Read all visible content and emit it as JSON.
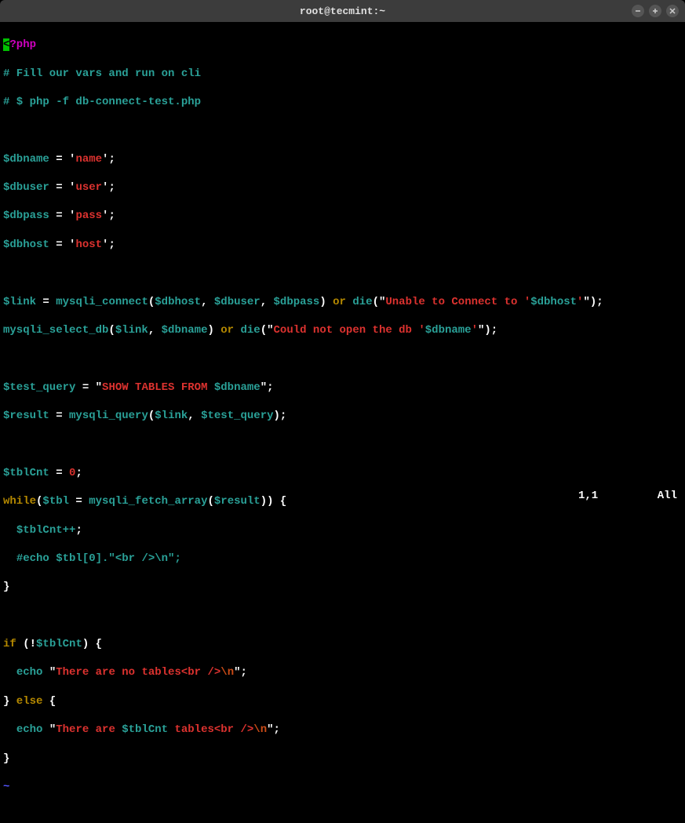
{
  "titlebar": {
    "title": "root@tecmint:~"
  },
  "code": {
    "open_tag": "<?php",
    "comment1": "# Fill our vars and run on cli",
    "comment2": "# $ php -f db-connect-test.php",
    "var_dbname": "$dbname",
    "eq": " = ",
    "q": "'",
    "val_name": "name",
    "semi": ";",
    "var_dbuser": "$dbuser",
    "val_user": "user",
    "var_dbpass": "$dbpass",
    "val_pass": "pass",
    "var_dbhost": "$dbhost",
    "val_host": "host",
    "var_link": "$link",
    "fn_connect": "mysqli_connect",
    "lp": "(",
    "rp": ")",
    "comma": ", ",
    "op_or": " or ",
    "fn_die": "die",
    "dq": "\"",
    "str_unable1": "Unable to Connect to ",
    "str_unable2": "'",
    "fn_selectdb": "mysqli_select_db",
    "str_could_not": "Could not open the db ",
    "var_test_query": "$test_query",
    "sql_show": "SHOW TABLES FROM ",
    "var_result": "$result",
    "fn_query": "mysqli_query",
    "var_tblcnt": "$tblCnt",
    "zero": "0",
    "kw_while": "while",
    "var_tbl": "$tbl",
    "fn_fetch": "mysqli_fetch_array",
    "brace_open": " {",
    "brace_close": "}",
    "indent_tblcnt": "  $tblCnt++",
    "indent_hash": "  #",
    "comment_echo": "echo $tbl[0].\"<br />\\n\";",
    "bracket_open": "[",
    "bracket_close": "]",
    "kw_if": "if ",
    "bang": "!",
    "kw_echo": "  echo ",
    "str_no_tables": "There are no tables",
    "str_br": "<br />",
    "str_newline": "\\n",
    "kw_else": " else ",
    "str_are": "There are ",
    "str_tables": " tables",
    "tilde": "~"
  },
  "status": {
    "pos": "1,1",
    "all": "All"
  }
}
